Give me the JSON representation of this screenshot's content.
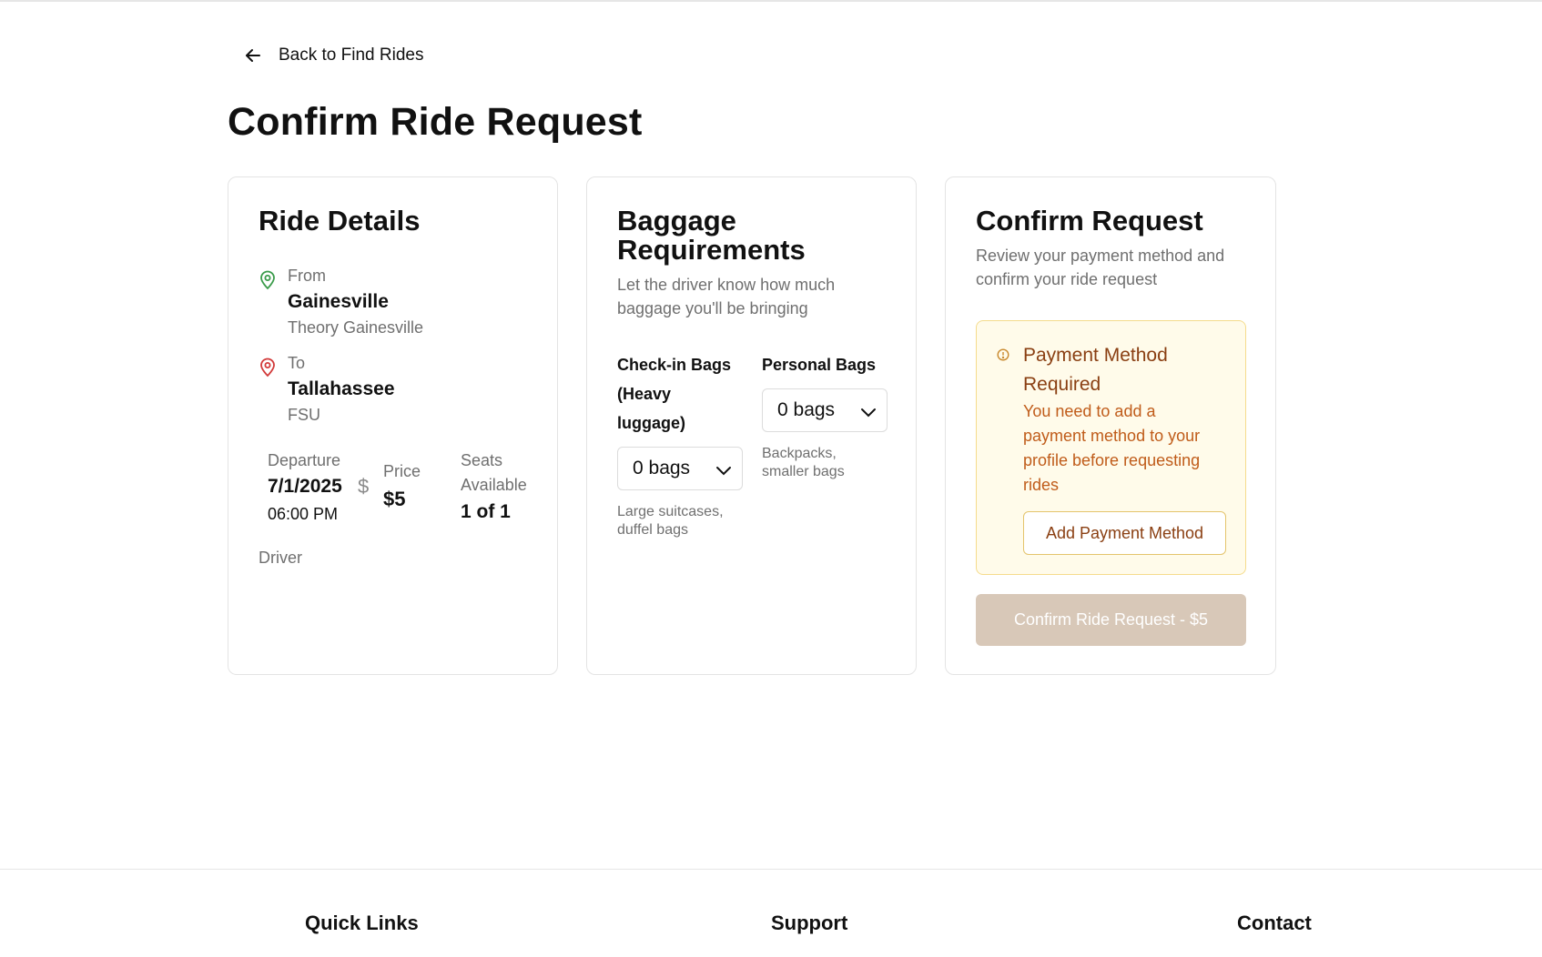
{
  "nav": {
    "back_label": "Back to Find Rides"
  },
  "page": {
    "title": "Confirm Ride Request"
  },
  "ride_details": {
    "title": "Ride Details",
    "from": {
      "key": "From",
      "city": "Gainesville",
      "place": "Theory Gainesville"
    },
    "to": {
      "key": "To",
      "city": "Tallahassee",
      "place": "FSU"
    },
    "departure": {
      "key": "Departure",
      "date": "7/1/2025",
      "time": "06:00 PM"
    },
    "price": {
      "key": "Price",
      "value": "$5"
    },
    "seats": {
      "key_line1": "Seats",
      "key_line2": "Available",
      "value": "1 of 1"
    },
    "driver_key": "Driver",
    "icon_from": "map-pin-icon",
    "icon_to": "map-pin-icon",
    "icon_price": "dollar-icon",
    "colors": {
      "from_pin": "#3a9b4a",
      "to_pin": "#d23a3a"
    }
  },
  "baggage": {
    "title_line1": "Baggage",
    "title_line2": "Requirements",
    "subtitle_line1": "Let the driver know how much",
    "subtitle_line2": "baggage you'll be bringing",
    "checkin": {
      "label_line1": "Check-in Bags",
      "label_line2": "(Heavy",
      "label_line3": "luggage)",
      "value": "0 bags",
      "hint_line1": "Large suitcases,",
      "hint_line2": "duffel bags"
    },
    "personal": {
      "label": "Personal Bags",
      "value": "0 bags",
      "hint_line1": "Backpacks,",
      "hint_line2": "smaller bags"
    }
  },
  "confirm": {
    "title": "Confirm Request",
    "subtitle_line1": "Review your payment method and",
    "subtitle_line2": "confirm your ride request",
    "alert": {
      "title_line1": "Payment Method",
      "title_line2": "Required",
      "body_line1": "You need to add a",
      "body_line2": "payment method to your",
      "body_line3": "profile before requesting",
      "body_line4": "rides",
      "button": "Add Payment Method",
      "colors": {
        "border": "#f5dc8c",
        "background": "#fffbea",
        "title": "#8a3f12",
        "body": "#c05c1a"
      }
    },
    "submit": "Confirm Ride Request - $5",
    "submit_color": "#d8c8b8"
  },
  "footer": {
    "col1": "Quick Links",
    "col2": "Support",
    "col3": "Contact"
  }
}
